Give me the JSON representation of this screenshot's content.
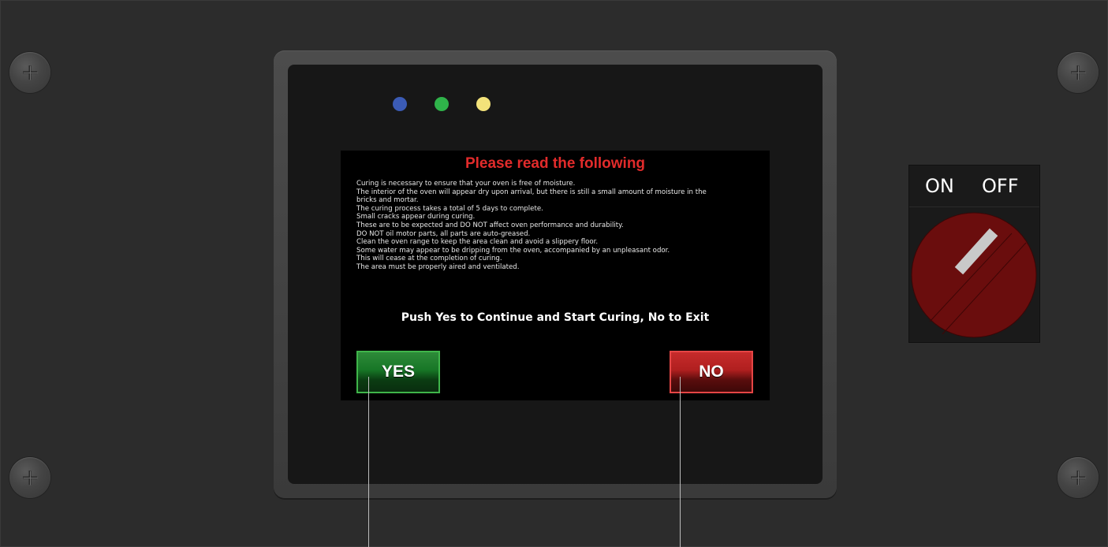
{
  "dialog": {
    "title": "Please read the following",
    "lines": [
      "Curing is necessary to ensure that your oven is free of moisture.",
      "The interior of the oven will appear dry upon arrival, but there is still a small amount of moisture in the",
      "bricks and mortar.",
      "The curing process takes a total of 5 days to complete.",
      "Small cracks appear during curing.",
      "These are to be expected and DO NOT affect oven performance and durability.",
      "DO NOT oil motor parts, all parts are auto-greased.",
      "Clean the oven range to keep the area clean and avoid a slippery floor.",
      "Some water may appear to be dripping from the oven, accompanied by an unpleasant odor.",
      "This will cease at the completion of curing.",
      "The area must be properly aired and ventilated."
    ],
    "prompt": "Push Yes to Continue and Start Curing, No to Exit",
    "yes_label": "YES",
    "no_label": "NO"
  },
  "switch": {
    "on_label": "ON",
    "off_label": "OFF",
    "position": "OFF"
  },
  "indicators": [
    {
      "name": "blue",
      "color": "#3b5bb5"
    },
    {
      "name": "green",
      "color": "#2fb34a"
    },
    {
      "name": "yellow",
      "color": "#f3e27a"
    }
  ],
  "colors": {
    "title_red": "#e22b2b",
    "yes_green": "#177626",
    "no_red": "#b01f1f",
    "knob_red": "#6a0d0d"
  }
}
